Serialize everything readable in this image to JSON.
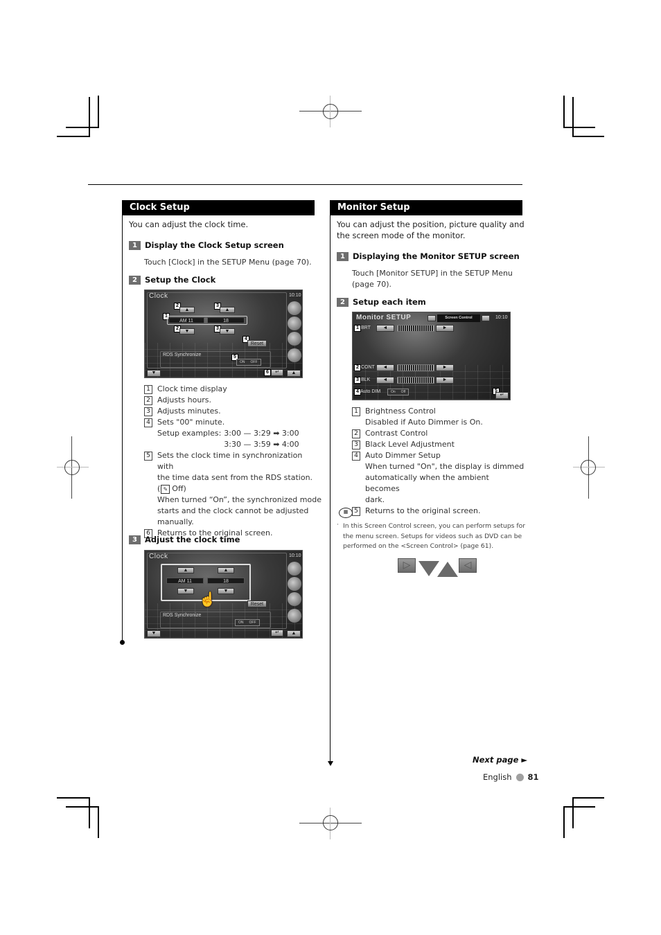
{
  "clock_setup": {
    "heading": "Clock Setup",
    "intro": "You can adjust the clock time.",
    "steps": [
      {
        "num": "1",
        "title": "Display the Clock Setup screen",
        "text": "Touch [Clock] in the SETUP Menu (page 70)."
      },
      {
        "num": "2",
        "title": "Setup the Clock"
      },
      {
        "num": "3",
        "title": "Adjust the clock time"
      }
    ],
    "screen": {
      "title": "Clock",
      "time": "10:10",
      "hour_value": "AM 11",
      "minute_value": "18",
      "up_arrow": "▲",
      "down_arrow": "▼",
      "reset_label": "Reset",
      "rds_label": "RDS Synchronize",
      "toggle_on": "ON",
      "toggle_off": "OFF",
      "callouts": [
        "1",
        "2",
        "2",
        "3",
        "3",
        "4",
        "5",
        "6"
      ]
    },
    "items": [
      {
        "num": "1",
        "text": "Clock time display"
      },
      {
        "num": "2",
        "text": "Adjusts hours."
      },
      {
        "num": "3",
        "text": "Adjusts minutes."
      },
      {
        "num": "4",
        "text": "Sets \"00\" minute."
      },
      {
        "num": "5",
        "text": "Sets the clock time in synchronization with\nthe time data sent from the RDS station."
      },
      {
        "num": "6",
        "text": "Returns to the original screen."
      }
    ],
    "setup_examples": {
      "label": "Setup examples:",
      "line1": "3:00 — 3:29 ➡ 3:00",
      "line2": "3:30 — 3:59 ➡ 4:00"
    },
    "item5_default": "Off)",
    "item5_note": "When turned “On”, the synchronized mode\nstarts and the clock cannot be adjusted\nmanually."
  },
  "monitor_setup": {
    "heading": "Monitor Setup",
    "intro": "You can adjust the position, picture quality and\nthe screen mode of the monitor.",
    "steps": [
      {
        "num": "1",
        "title": "Displaying the Monitor SETUP screen",
        "text": "Touch [Monitor SETUP] in the SETUP Menu\n(page 70)."
      },
      {
        "num": "2",
        "title": "Setup each item"
      }
    ],
    "screen": {
      "title": "Monitor SETUP",
      "tab_label": "Screen Control",
      "time": "10:10",
      "rows": [
        {
          "num": "1",
          "label": "BRT"
        },
        {
          "num": "2",
          "label": "CONT"
        },
        {
          "num": "3",
          "label": "BLK"
        }
      ],
      "auto_dim_num": "4",
      "auto_dim_label": "Auto DIM",
      "toggle_on": "On",
      "toggle_off": "Off",
      "return_num": "5",
      "left_arrow": "◄",
      "right_arrow": "►"
    },
    "items": [
      {
        "num": "1",
        "text": "Brightness Control\nDisabled if Auto Dimmer is On."
      },
      {
        "num": "2",
        "text": "Contrast Control"
      },
      {
        "num": "3",
        "text": "Black Level Adjustment"
      },
      {
        "num": "4",
        "text": "Auto Dimmer Setup\nWhen turned \"On\", the display is dimmed\nautomatically when the ambient becomes\ndark."
      },
      {
        "num": "5",
        "text": "Returns to the original screen."
      }
    ],
    "note": "In this Screen Control screen, you can perform setups for\nthe menu screen. Setups for videos such as DVD can be\nperformed on the <Screen Control> (page 61)."
  },
  "footer": {
    "next_page": "Next page ►",
    "language": "English",
    "page_number": "81"
  }
}
